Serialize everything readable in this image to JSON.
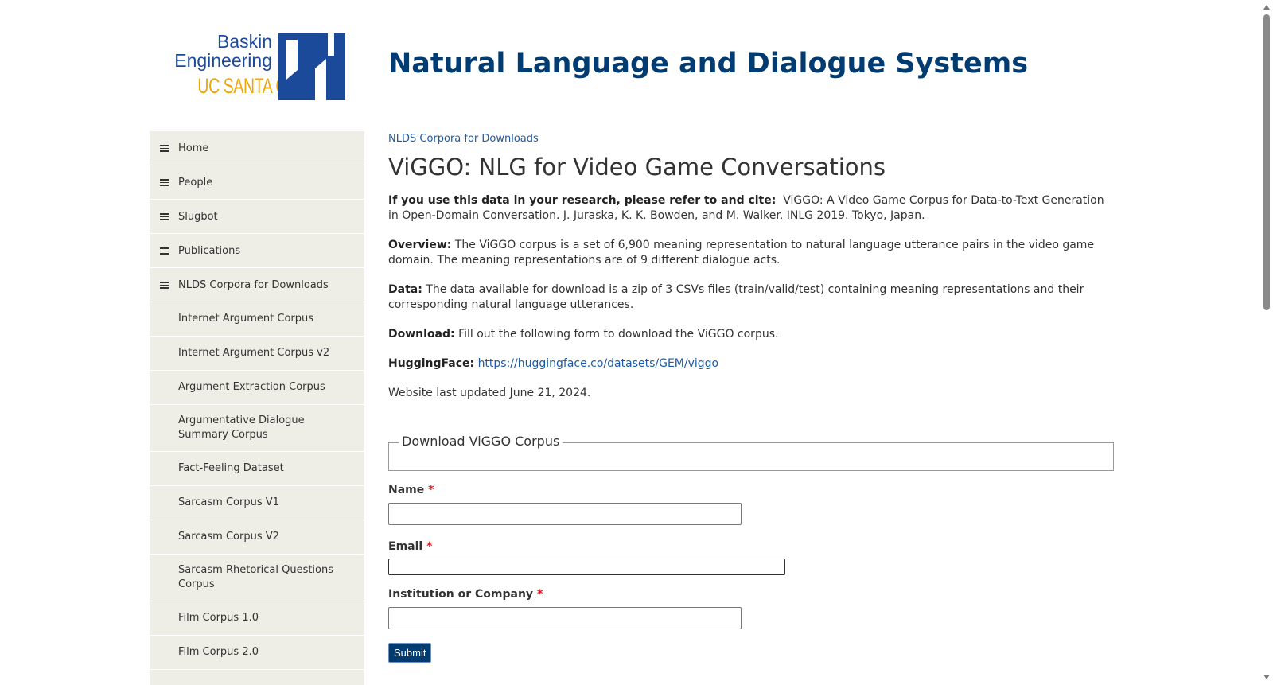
{
  "header": {
    "logo": {
      "line1": "Baskin",
      "line2": "Engineering",
      "line3": "UC SANTA CRUZ",
      "accent_blue": "#1c4a9a",
      "accent_gold": "#f0a500"
    },
    "site_title": "Natural Language and Dialogue Systems"
  },
  "sidebar": {
    "items": [
      {
        "label": "Home",
        "icon": "menu-icon"
      },
      {
        "label": "People",
        "icon": "menu-icon"
      },
      {
        "label": "Slugbot",
        "icon": "menu-icon"
      },
      {
        "label": "Publications",
        "icon": "menu-icon"
      },
      {
        "label": "NLDS Corpora for Downloads",
        "icon": "menu-icon"
      }
    ],
    "subitems": [
      "Internet Argument Corpus",
      "Internet Argument Corpus v2",
      "Argument Extraction Corpus",
      "Argumentative Dialogue Summary Corpus",
      "Fact-Feeling Dataset",
      "Sarcasm Corpus V1",
      "Sarcasm Corpus V2",
      "Sarcasm Rhetorical Questions Corpus",
      "Film Corpus 1.0",
      "Film Corpus 2.0"
    ]
  },
  "main": {
    "breadcrumb": "NLDS Corpora for Downloads",
    "title": "ViGGO: NLG for Video Game Conversations",
    "cite_label": "If you use this data in your research, please refer to and cite:",
    "cite_text": "ViGGO: A Video Game Corpus for Data-to-Text Generation in Open-Domain Conversation. J. Juraska, K. K. Bowden, and M. Walker. INLG 2019. Tokyo, Japan.",
    "overview_label": "Overview:",
    "overview_text": "The ViGGO corpus is a set of 6,900 meaning representation to natural language utterance pairs in the video game domain. The meaning representations are of 9 different dialogue acts.",
    "data_label": "Data:",
    "data_text": "The data available for download is a zip of 3 CSVs files (train/valid/test) containing meaning representations and their corresponding natural language utterances.",
    "download_label": "Download:",
    "download_text": "Fill out the following form to download the ViGGO corpus.",
    "hf_label": "HuggingFace:",
    "hf_link": "https://huggingface.co/datasets/GEM/viggo",
    "updated": "Website last updated June 21, 2024."
  },
  "form": {
    "legend": "Download ViGGO Corpus",
    "required_mark": "*",
    "name_label": "Name",
    "email_label": "Email",
    "institution_label": "Institution or Company",
    "submit_label": "Submit"
  }
}
